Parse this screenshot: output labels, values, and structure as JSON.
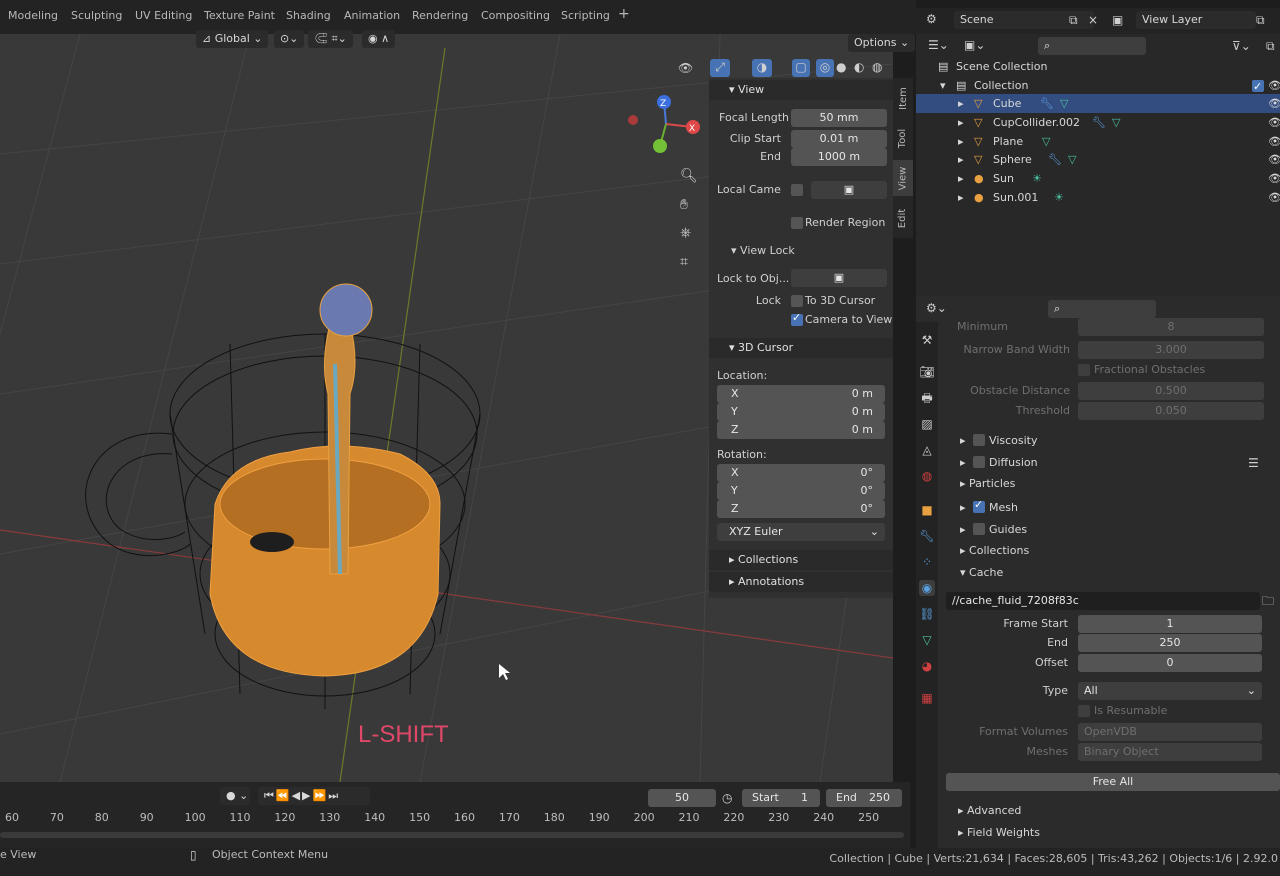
{
  "workspace_tabs": [
    "Modeling",
    "Sculpting",
    "UV Editing",
    "Texture Paint",
    "Shading",
    "Animation",
    "Rendering",
    "Compositing",
    "Scripting"
  ],
  "add_tab_label": "+",
  "scene": {
    "label": "Scene",
    "view_layer": "View Layer"
  },
  "viewport_header": {
    "transform": "Global",
    "options": "Options"
  },
  "overlay_text": "L-SHIFT",
  "npanel": {
    "tabs": [
      "Item",
      "Tool",
      "View",
      "Edit"
    ],
    "view": {
      "title": "View",
      "focal_length_label": "Focal Length",
      "focal_length": "50 mm",
      "clip_start_label": "Clip Start",
      "clip_start": "0.01 m",
      "end_label": "End",
      "end": "1000 m",
      "local_camera_label": "Local Came",
      "render_region_label": "Render Region"
    },
    "view_lock": {
      "title": "View Lock",
      "lock_to_obj_label": "Lock to Obj...",
      "lock_label": "Lock",
      "to_3d_cursor_label": "To 3D Cursor",
      "camera_to_view_label": "Camera to View"
    },
    "cursor": {
      "title": "3D Cursor",
      "location_label": "Location:",
      "rotation_label": "Rotation:",
      "loc": [
        {
          "axis": "X",
          "value": "0 m"
        },
        {
          "axis": "Y",
          "value": "0 m"
        },
        {
          "axis": "Z",
          "value": "0 m"
        }
      ],
      "rot": [
        {
          "axis": "X",
          "value": "0°"
        },
        {
          "axis": "Y",
          "value": "0°"
        },
        {
          "axis": "Z",
          "value": "0°"
        }
      ],
      "rotation_mode": "XYZ Euler"
    },
    "collections_label": "Collections",
    "annotations_label": "Annotations"
  },
  "outliner": {
    "scene_collection": "Scene Collection",
    "collection": "Collection",
    "items": [
      {
        "name": "Cube",
        "selected": true,
        "color": "#e8a040"
      },
      {
        "name": "CupCollider.002",
        "selected": false,
        "color": "#e8a040"
      },
      {
        "name": "Plane",
        "selected": false,
        "color": "#e8a040"
      },
      {
        "name": "Sphere",
        "selected": false,
        "color": "#e8a040"
      },
      {
        "name": "Sun",
        "selected": false,
        "color": "#e8a040"
      },
      {
        "name": "Sun.001",
        "selected": false,
        "color": "#e8a040"
      }
    ]
  },
  "properties": {
    "faded_rows": [
      {
        "label": "Minimum",
        "value": "8"
      },
      {
        "label": "Narrow Band Width",
        "value": "3.000"
      }
    ],
    "fractional_obstacles": "Fractional Obstacles",
    "faded_rows2": [
      {
        "label": "Obstacle Distance",
        "value": "0.500"
      },
      {
        "label": "Threshold",
        "value": "0.050"
      }
    ],
    "sections": [
      {
        "label": "Viscosity",
        "checkbox": true,
        "checked": false
      },
      {
        "label": "Diffusion",
        "checkbox": true,
        "checked": false
      },
      {
        "label": "Particles",
        "checkbox": false,
        "checked": false
      },
      {
        "label": "Mesh",
        "checkbox": true,
        "checked": true
      },
      {
        "label": "Guides",
        "checkbox": true,
        "checked": false
      },
      {
        "label": "Collections",
        "checkbox": false,
        "checked": false
      },
      {
        "label": "Cache",
        "checkbox": false,
        "checked": false
      }
    ],
    "cache_path": "//cache_fluid_7208f83c",
    "frame_start_label": "Frame Start",
    "frame_start": "1",
    "end_label": "End",
    "end": "250",
    "offset_label": "Offset",
    "offset": "0",
    "type_label": "Type",
    "type": "All",
    "is_resumable": "Is Resumable",
    "format_volumes_label": "Format Volumes",
    "format_volumes": "OpenVDB",
    "meshes_label": "Meshes",
    "meshes": "Binary Object",
    "free_all": "Free All",
    "advanced": "Advanced",
    "field_weights": "Field Weights"
  },
  "timeline": {
    "current_frame": "50",
    "start_label": "Start",
    "start": "1",
    "end_label": "End",
    "end": "250",
    "ticks": [
      "60",
      "70",
      "80",
      "90",
      "100",
      "110",
      "120",
      "130",
      "140",
      "150",
      "160",
      "170",
      "180",
      "190",
      "200",
      "210",
      "220",
      "230",
      "240",
      "250"
    ]
  },
  "status": {
    "left": "e View",
    "context_menu": "Object Context Menu",
    "right": "Collection | Cube | Verts:21,634 | Faces:28,605 | Tris:43,262 | Objects:1/6 | 2.92.0"
  }
}
